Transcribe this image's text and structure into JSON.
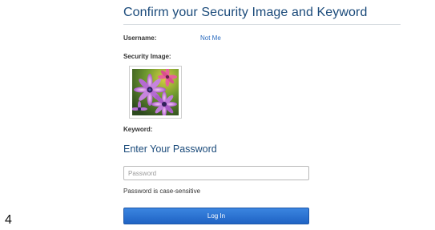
{
  "header": {
    "title": "Confirm your Security Image and Keyword"
  },
  "identity": {
    "username_label": "Username:",
    "not_me_link": "Not Me",
    "security_image_label": "Security Image:",
    "security_image_icon": "purple-flowers-image",
    "keyword_label": "Keyword:"
  },
  "password_section": {
    "title": "Enter Your Password",
    "password_placeholder": "Password",
    "password_value": "",
    "hint": "Password is case-sensitive",
    "login_label": "Log In"
  },
  "corner_number": "4",
  "colors": {
    "heading": "#1a4a7a",
    "link": "#2a6bbf",
    "button": "#2a6fd1"
  }
}
